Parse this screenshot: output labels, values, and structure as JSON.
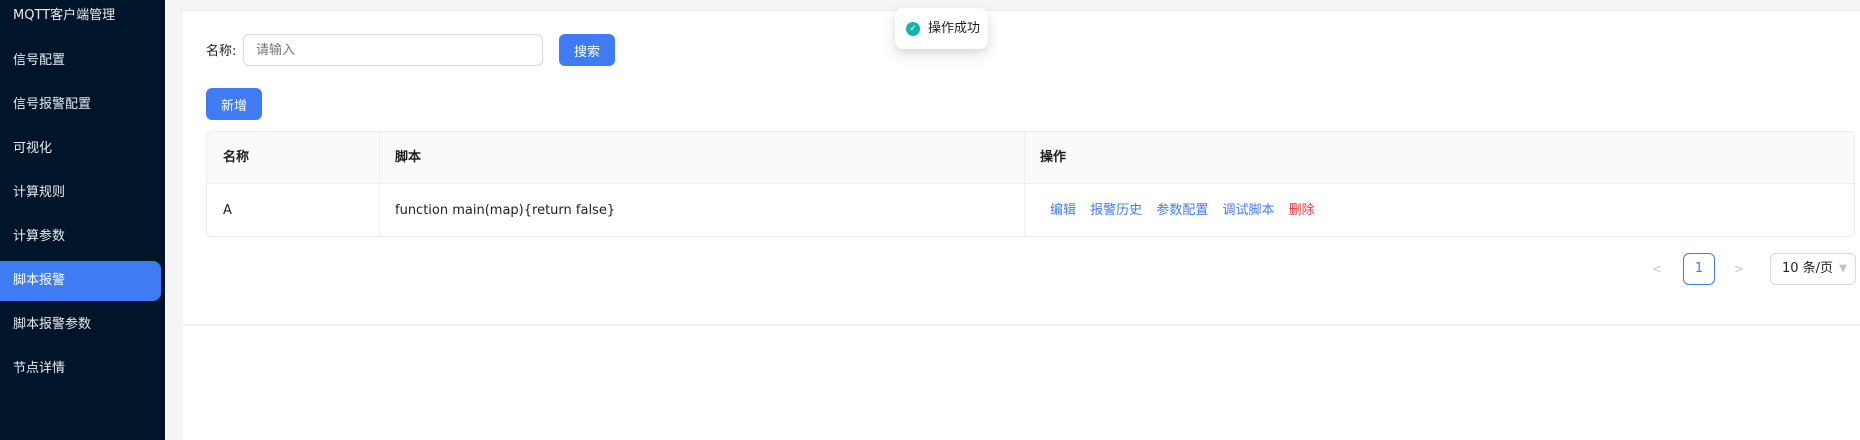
{
  "sidebar": {
    "items": [
      {
        "label": "MQTT客户端管理",
        "active": false
      },
      {
        "label": "信号配置",
        "active": false
      },
      {
        "label": "信号报警配置",
        "active": false
      },
      {
        "label": "可视化",
        "active": false
      },
      {
        "label": "计算规则",
        "active": false
      },
      {
        "label": "计算参数",
        "active": false
      },
      {
        "label": "脚本报警",
        "active": true
      },
      {
        "label": "脚本报警参数",
        "active": false
      },
      {
        "label": "节点详情",
        "active": false
      }
    ]
  },
  "search": {
    "label": "名称:",
    "placeholder": "请输入",
    "button": "搜索"
  },
  "toolbar": {
    "add": "新增"
  },
  "table": {
    "headers": [
      "名称",
      "脚本",
      "操作"
    ],
    "rows": [
      {
        "name": "A",
        "script": "function main(map){return false}",
        "actions": {
          "edit": "编辑",
          "history": "报警历史",
          "params": "参数配置",
          "debug": "调试脚本",
          "delete": "删除"
        }
      }
    ]
  },
  "pagination": {
    "prev": "<",
    "current": "1",
    "next": ">",
    "page_size": "10 条/页"
  },
  "toast": {
    "message": "操作成功",
    "icon": "check-circle-icon"
  },
  "colors": {
    "primary": "#3f7cf4",
    "danger": "#e6393e",
    "sidebar": "#001529",
    "success": "#16b4a5"
  }
}
